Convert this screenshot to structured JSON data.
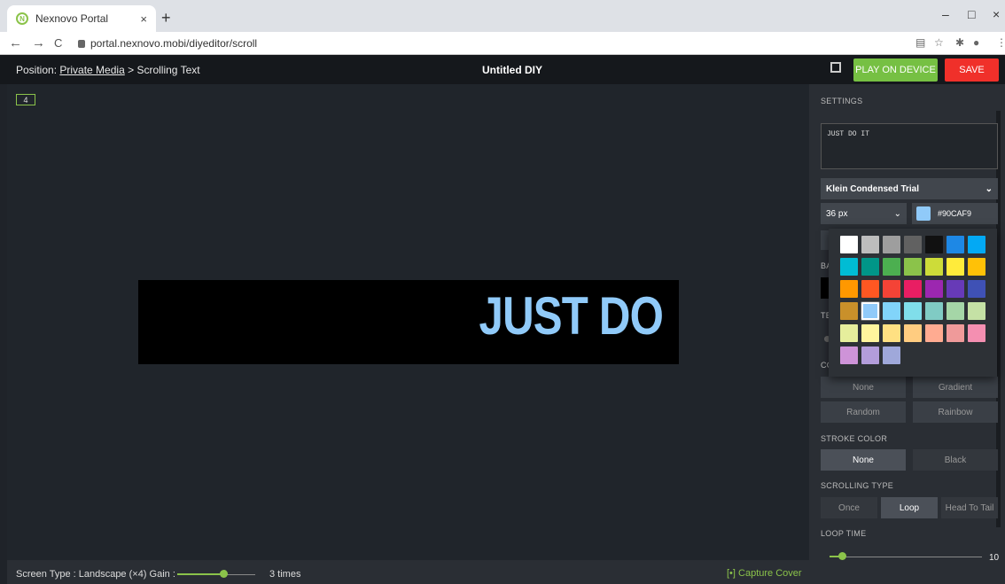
{
  "browser": {
    "tab_title": "Nexnovo Portal",
    "tab_close": "×",
    "new_tab": "+",
    "url": "portal.nexnovo.mobi/diyeditor/scroll",
    "window_controls": [
      "–",
      "□",
      "×"
    ]
  },
  "header": {
    "position_label": "Position:",
    "position_link": "Private Media",
    "separator": ">",
    "position_current": "Scrolling Text",
    "doc_title": "Untitled DIY",
    "play_label": "PLAY ON DEVICE",
    "save_label": "SAVE",
    "play_color": "#76c043",
    "save_color": "#f0302a"
  },
  "canvas": {
    "page_badge": "4",
    "preview_text": "JUST DO"
  },
  "bottom": {
    "screen_type": "Screen Type :  Landscape (×4)   Gain :",
    "gain_value": "3 times",
    "capture_label": "Capture Cover"
  },
  "settings": {
    "title": "SETTINGS",
    "text_value": "JUST DO IT",
    "font": "Klein Condensed Trial",
    "font_size": "36 px",
    "color_hex": "#90CAF9",
    "partial_labels": [
      "BA",
      "TE",
      "CO"
    ],
    "color_mode": [
      "None",
      "Gradient",
      "Random",
      "Rainbow"
    ],
    "stroke_title": "STROKE COLOR",
    "stroke_options": [
      "None",
      "Black"
    ],
    "scroll_title": "SCROLLING TYPE",
    "scroll_options": [
      "Once",
      "Loop",
      "Head To Tail"
    ],
    "loop_title": "LOOP TIME",
    "loop_value": "10"
  },
  "palette": {
    "selected": "#90CAF9",
    "colors": [
      "#ffffff",
      "#bdbdbd",
      "#9e9e9e",
      "#616161",
      "#111111",
      "#1e88e5",
      "#03a9f4",
      "#00bcd4",
      "#009688",
      "#4caf50",
      "#8bc34a",
      "#cddc39",
      "#ffeb3b",
      "#ffc107",
      "#ff9800",
      "#ff5722",
      "#f44336",
      "#e91e63",
      "#9c27b0",
      "#673ab7",
      "#3f51b5",
      "#c9902a",
      "#90CAF9",
      "#81d4fa",
      "#80deea",
      "#80cbc4",
      "#a5d6a7",
      "#c5e1a5",
      "#e6ee9c",
      "#fff59d",
      "#ffe082",
      "#ffcc80",
      "#ffab91",
      "#ef9a9a",
      "#f48fb1",
      "#ce93d8",
      "#b39ddb",
      "#9fa8da"
    ]
  }
}
